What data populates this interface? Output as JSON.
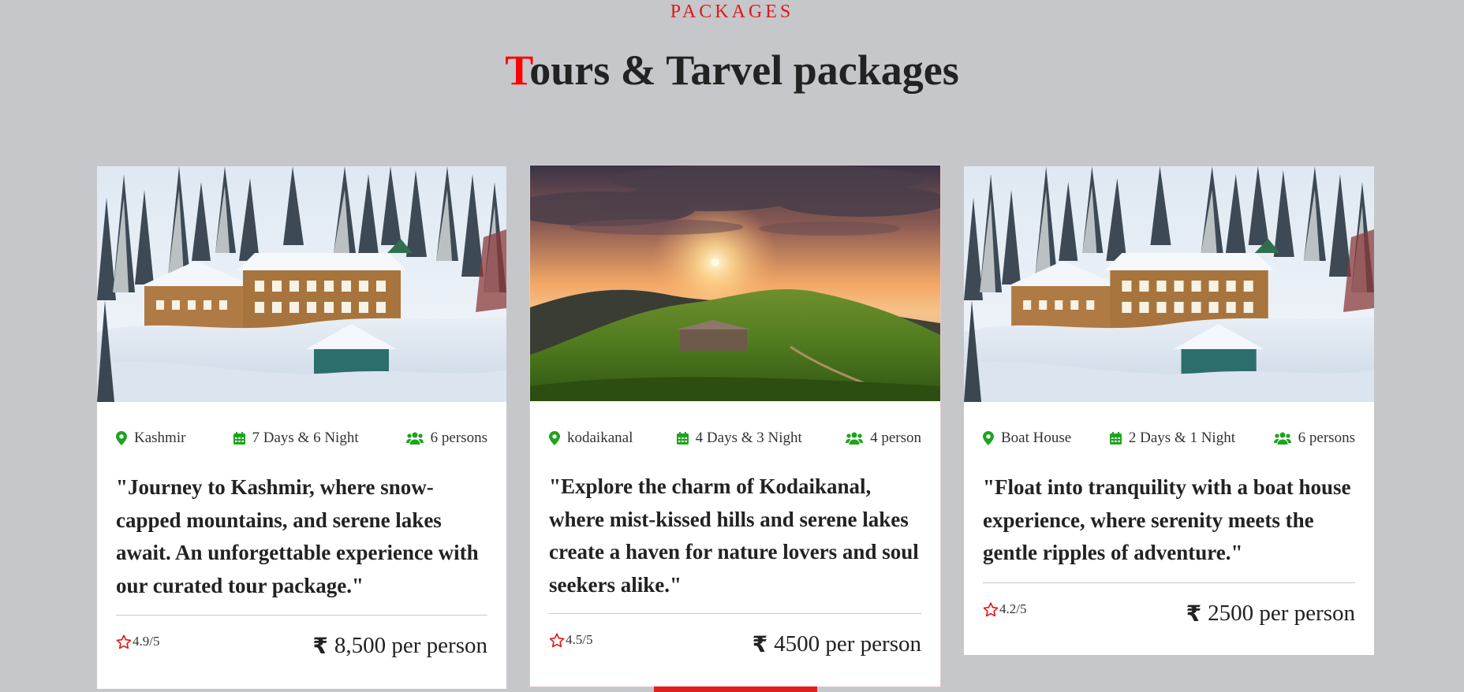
{
  "section": {
    "eyebrow": "PACKAGES",
    "title_first_letter": "T",
    "title_rest": "ours & Tarvel packages"
  },
  "colors": {
    "accent_red": "#e01818",
    "icon_green": "#1fa31f",
    "background": "#c6c7cb",
    "card_background": "#ffffff"
  },
  "packages": [
    {
      "location": "Kashmir",
      "duration": "7 Days & 6 Night",
      "persons": "6 persons",
      "description": "\"Journey to Kashmir, where snow-capped mountains, and serene lakes await. An unforgettable experience with our curated tour package.\"",
      "rating": "4.9/5",
      "currency": "₹",
      "price": "8,500 per person",
      "image": "snowy-resort-photo"
    },
    {
      "location": "kodaikanal",
      "duration": "4 Days & 3 Night",
      "persons": "4 person",
      "description": "\"Explore the charm of Kodaikanal, where mist-kissed hills and serene lakes create a haven for nature lovers and soul seekers alike.\"",
      "rating": "4.5/5",
      "currency": "₹",
      "price": "4500 per person",
      "image": "sunset-hill-photo"
    },
    {
      "location": "Boat House",
      "duration": "2 Days & 1 Night",
      "persons": "6 persons",
      "description": "\"Float into tranquility with a boat house experience, where serenity meets the gentle ripples of adventure.\"",
      "rating": "4.2/5",
      "currency": "₹",
      "price": "2500 per person",
      "image": "snowy-resort-photo"
    }
  ]
}
